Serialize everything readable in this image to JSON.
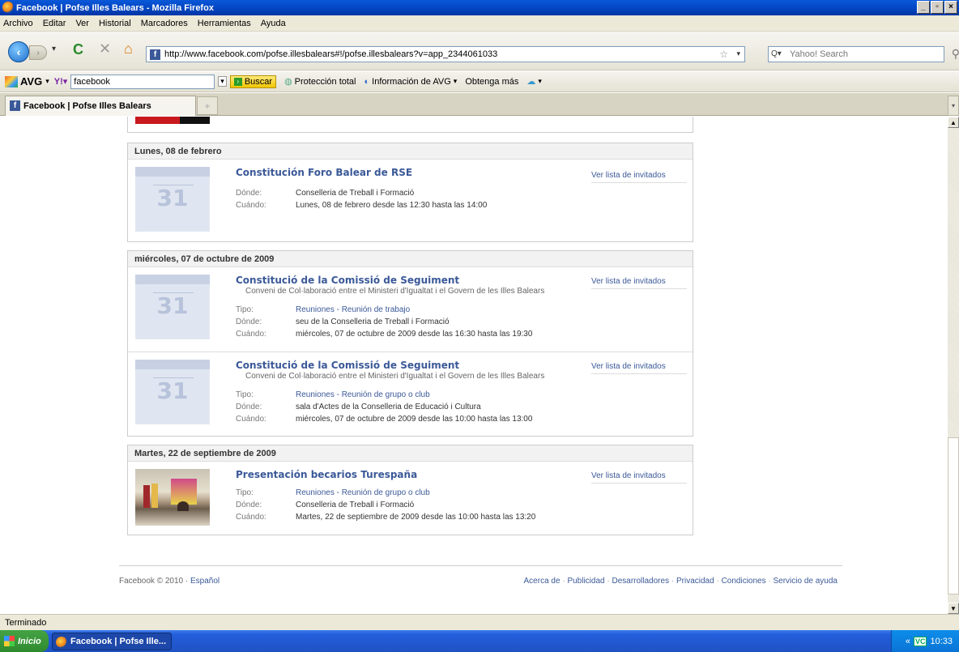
{
  "window": {
    "title": "Facebook | Pofse Illes Balears - Mozilla Firefox",
    "controls": [
      "_",
      "▫",
      "×"
    ]
  },
  "menu": [
    "Archivo",
    "Editar",
    "Ver",
    "Historial",
    "Marcadores",
    "Herramientas",
    "Ayuda"
  ],
  "nav": {
    "url": "http://www.facebook.com/pofse.illesbalears#!/pofse.illesbalears?v=app_2344061033",
    "search_placeholder": "Yahoo! Search"
  },
  "avg_toolbar": {
    "brand": "AVG",
    "search_value": "facebook",
    "buscar": "Buscar",
    "proteccion": "Protección total",
    "informacion": "Información de AVG",
    "obtenga": "Obtenga más"
  },
  "tab": {
    "title": "Facebook | Pofse Illes Balears"
  },
  "events": {
    "sections": [
      {
        "date": "Lunes, 08 de febrero",
        "items": [
          {
            "title": "Constitución Foro Balear de RSE",
            "donde_label": "Dónde:",
            "donde": "Conselleria de Treball i Formació",
            "cuando_label": "Cuándo:",
            "cuando": "Lunes, 08 de febrero desde las 12:30 hasta las 14:00",
            "guests": "Ver lista de invitados",
            "cal": "31"
          }
        ]
      },
      {
        "date": "miércoles, 07 de octubre de 2009",
        "items": [
          {
            "title": "Constitució de la Comissió de Seguiment",
            "subtitle": "Conveni de Col·laboració entre el Ministeri d'Igualtat i el Govern de les Illes Balears",
            "tipo_label": "Tipo:",
            "tipo": "Reuniones - Reunión de trabajo",
            "donde_label": "Dónde:",
            "donde": "seu de la Conselleria de Treball i Formació",
            "cuando_label": "Cuándo:",
            "cuando": "miércoles, 07 de octubre de 2009 desde las 16:30 hasta las 19:30",
            "guests": "Ver lista de invitados",
            "cal": "31"
          },
          {
            "title": "Constitució de la Comissió de Seguiment",
            "subtitle": "Conveni de Col·laboració entre el Ministeri d'Igualtat i el Govern de les Illes Balears",
            "tipo_label": "Tipo:",
            "tipo": "Reuniones - Reunión de grupo o club",
            "donde_label": "Dónde:",
            "donde": "sala d'Actes de la Conselleria de Educació i Cultura",
            "cuando_label": "Cuándo:",
            "cuando": "miércoles, 07 de octubre de 2009 desde las 10:00 hasta las 13:00",
            "guests": "Ver lista de invitados",
            "cal": "31"
          }
        ]
      },
      {
        "date": "Martes, 22 de septiembre de 2009",
        "items": [
          {
            "title": "Presentación becarios Turespaña",
            "tipo_label": "Tipo:",
            "tipo": "Reuniones - Reunión de grupo o club",
            "donde_label": "Dónde:",
            "donde": "Conselleria de Treball i Formació",
            "cuando_label": "Cuándo:",
            "cuando": "Martes, 22 de septiembre de 2009 desde las 10:00 hasta las 13:20",
            "guests": "Ver lista de invitados"
          }
        ]
      }
    ]
  },
  "footer": {
    "copyright": "Facebook © 2010 · ",
    "language": "Español",
    "links": [
      "Acerca de",
      "Publicidad",
      "Desarrolladores",
      "Privacidad",
      "Condiciones",
      "Servicio de ayuda"
    ]
  },
  "status": "Terminado",
  "taskbar": {
    "start": "Inicio",
    "task": "Facebook | Pofse Ille...",
    "clock": "10:33",
    "tray_badge": "VC"
  },
  "colors": {
    "link": "#3b5998",
    "titlebar": "#0347c4"
  }
}
